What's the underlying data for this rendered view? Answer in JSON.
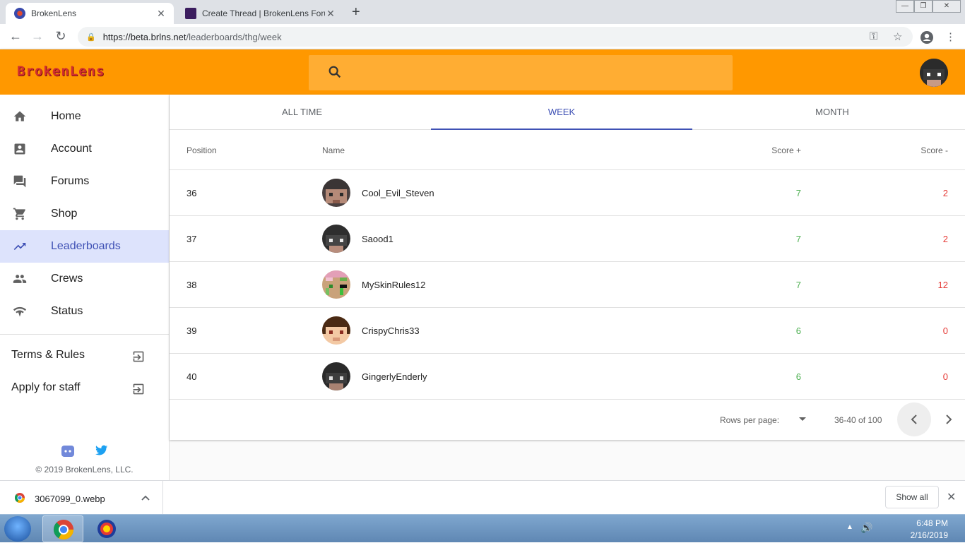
{
  "browser": {
    "tabs": [
      {
        "title": "BrokenLens",
        "active": true
      },
      {
        "title": "Create Thread | BrokenLens Forum",
        "active": false
      }
    ],
    "url_host": "https://beta.brlns.net",
    "url_path": "/leaderboards/thg/week"
  },
  "site": {
    "logo": "BrokenLens",
    "search_placeholder": ""
  },
  "sidebar": {
    "items": [
      {
        "label": "Home",
        "icon": "home-icon"
      },
      {
        "label": "Account",
        "icon": "account-box-icon"
      },
      {
        "label": "Forums",
        "icon": "forum-icon"
      },
      {
        "label": "Shop",
        "icon": "shopping-cart-icon"
      },
      {
        "label": "Leaderboards",
        "icon": "trending-up-icon",
        "active": true
      },
      {
        "label": "Crews",
        "icon": "people-icon"
      },
      {
        "label": "Status",
        "icon": "signal-icon"
      }
    ],
    "links": [
      {
        "label": "Terms & Rules"
      },
      {
        "label": "Apply for staff"
      }
    ],
    "copyright": "© 2019 BrokenLens, LLC."
  },
  "leaderboard": {
    "tabs": [
      "ALL TIME",
      "WEEK",
      "MONTH"
    ],
    "active_tab": "WEEK",
    "columns": {
      "position": "Position",
      "name": "Name",
      "score_plus": "Score +",
      "score_minus": "Score -"
    },
    "rows": [
      {
        "position": "36",
        "name": "Cool_Evil_Steven",
        "score_plus": "7",
        "score_minus": "2"
      },
      {
        "position": "37",
        "name": "Saood1",
        "score_plus": "7",
        "score_minus": "2"
      },
      {
        "position": "38",
        "name": "MySkinRules12",
        "score_plus": "7",
        "score_minus": "12"
      },
      {
        "position": "39",
        "name": "CrispyChris33",
        "score_plus": "6",
        "score_minus": "0"
      },
      {
        "position": "40",
        "name": "GingerlyEnderly",
        "score_plus": "6",
        "score_minus": "0"
      }
    ],
    "pagination": {
      "rows_per_page_label": "Rows per page:",
      "range": "36-40 of 100"
    }
  },
  "downloads": {
    "file": "3067099_0.webp",
    "show_all": "Show all"
  },
  "taskbar": {
    "time": "6:48 PM",
    "date": "2/16/2019"
  },
  "colors": {
    "header": "#ff9800",
    "accent": "#3f51b5",
    "score_plus": "#4caf50",
    "score_minus": "#e53935"
  }
}
